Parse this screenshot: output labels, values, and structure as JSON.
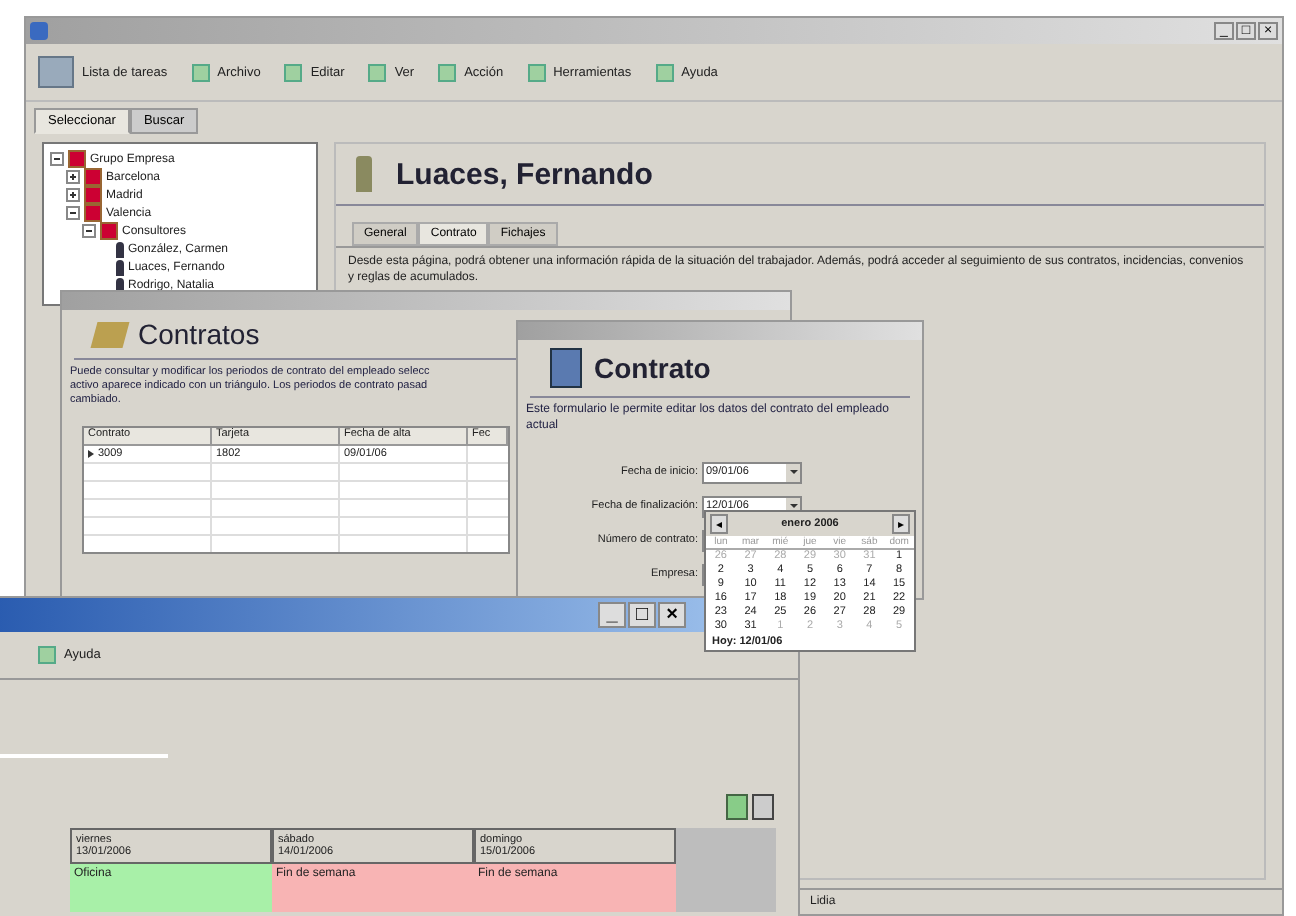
{
  "main_window": {
    "controls": [
      "_",
      "□",
      "×"
    ],
    "toolbar": [
      {
        "label": "Lista de tareas",
        "kind": "large"
      },
      {
        "label": "Archivo",
        "kind": "small"
      },
      {
        "label": "Editar",
        "kind": "small"
      },
      {
        "label": "Ver",
        "kind": "small"
      },
      {
        "label": "Acción",
        "kind": "small"
      },
      {
        "label": "Herramientas",
        "kind": "small"
      },
      {
        "label": "Ayuda",
        "kind": "small"
      }
    ],
    "side_tabs": [
      {
        "label": "Seleccionar",
        "selected": true
      },
      {
        "label": "Buscar",
        "selected": false
      }
    ],
    "tree": [
      {
        "label": "Grupo Empresa",
        "expanded": true,
        "kind": "group",
        "children": [
          {
            "label": "Barcelona",
            "expanded": false,
            "kind": "group"
          },
          {
            "label": "Madrid",
            "expanded": false,
            "kind": "group"
          },
          {
            "label": "Valencia",
            "expanded": true,
            "kind": "group",
            "children": [
              {
                "label": "Consultores",
                "expanded": true,
                "kind": "group",
                "children": [
                  {
                    "label": "González, Carmen",
                    "kind": "person"
                  },
                  {
                    "label": "Luaces, Fernando",
                    "kind": "person"
                  },
                  {
                    "label": "Rodrigo, Natalia",
                    "kind": "person"
                  }
                ]
              }
            ]
          }
        ]
      }
    ],
    "employee": "Luaces, Fernando",
    "tabs": [
      {
        "label": "General",
        "selected": false
      },
      {
        "label": "Contrato",
        "selected": true
      },
      {
        "label": "Fichajes",
        "selected": false
      }
    ],
    "description": "Desde esta página, podrá obtener una información rápida de la situación del trabajador. Además, podrá acceder al seguimiento de sus contratos, incidencias, convenios y reglas de acumulados.",
    "status": "Lidia"
  },
  "contracts_window": {
    "heading": "Contratos",
    "text_lines": [
      "Puede consultar y modificar los periodos de contrato del empleado selecc",
      "activo aparece indicado con un triángulo. Los periodos de contrato pasad",
      "cambiado."
    ],
    "columns": [
      "Contrato",
      "Tarjeta",
      "Fecha de alta",
      "Fec"
    ],
    "rows": [
      [
        "3009",
        "1802",
        "09/01/06"
      ]
    ]
  },
  "contract_dialog": {
    "heading": "Contrato",
    "text": "Este formulario le permite editar los datos del contrato del empleado actual",
    "fields": [
      {
        "label": "Fecha de inicio:",
        "value": "09/01/06",
        "kind": "date"
      },
      {
        "label": "Fecha de finalización:",
        "value": "12/01/06",
        "kind": "date"
      },
      {
        "label": "Número de contrato:",
        "kind": "text"
      },
      {
        "label": "Empresa:",
        "kind": "text"
      }
    ]
  },
  "calendar": {
    "prev": "◂",
    "next": "▸",
    "month": "enero 2006",
    "weekdays": [
      "lun",
      "mar",
      "mié",
      "jue",
      "vie",
      "sáb",
      "dom"
    ],
    "weeks": [
      [
        "26",
        "27",
        "28",
        "29",
        "30",
        "31",
        "1"
      ],
      [
        "2",
        "3",
        "4",
        "5",
        "6",
        "7",
        "8"
      ],
      [
        "9",
        "10",
        "11",
        "12",
        "13",
        "14",
        "15"
      ],
      [
        "16",
        "17",
        "18",
        "19",
        "20",
        "21",
        "22"
      ],
      [
        "23",
        "24",
        "25",
        "26",
        "27",
        "28",
        "29"
      ],
      [
        "30",
        "31",
        "1",
        "2",
        "3",
        "4",
        "5"
      ]
    ],
    "today": "Hoy: 12/01/06"
  },
  "front_window": {
    "controls": [
      "_",
      "□",
      "×"
    ],
    "menu": [
      {
        "label": "Ayuda"
      }
    ],
    "days": [
      {
        "day": "viernes",
        "date": "13/01/2006",
        "entry": "Oficina",
        "color": "#a8f0a8"
      },
      {
        "day": "sábado",
        "date": "14/01/2006",
        "entry": "Fin de semana",
        "color": "#f8b4b4"
      },
      {
        "day": "domingo",
        "date": "15/01/2006",
        "entry": "Fin de semana",
        "color": "#f8b4b4"
      }
    ]
  }
}
